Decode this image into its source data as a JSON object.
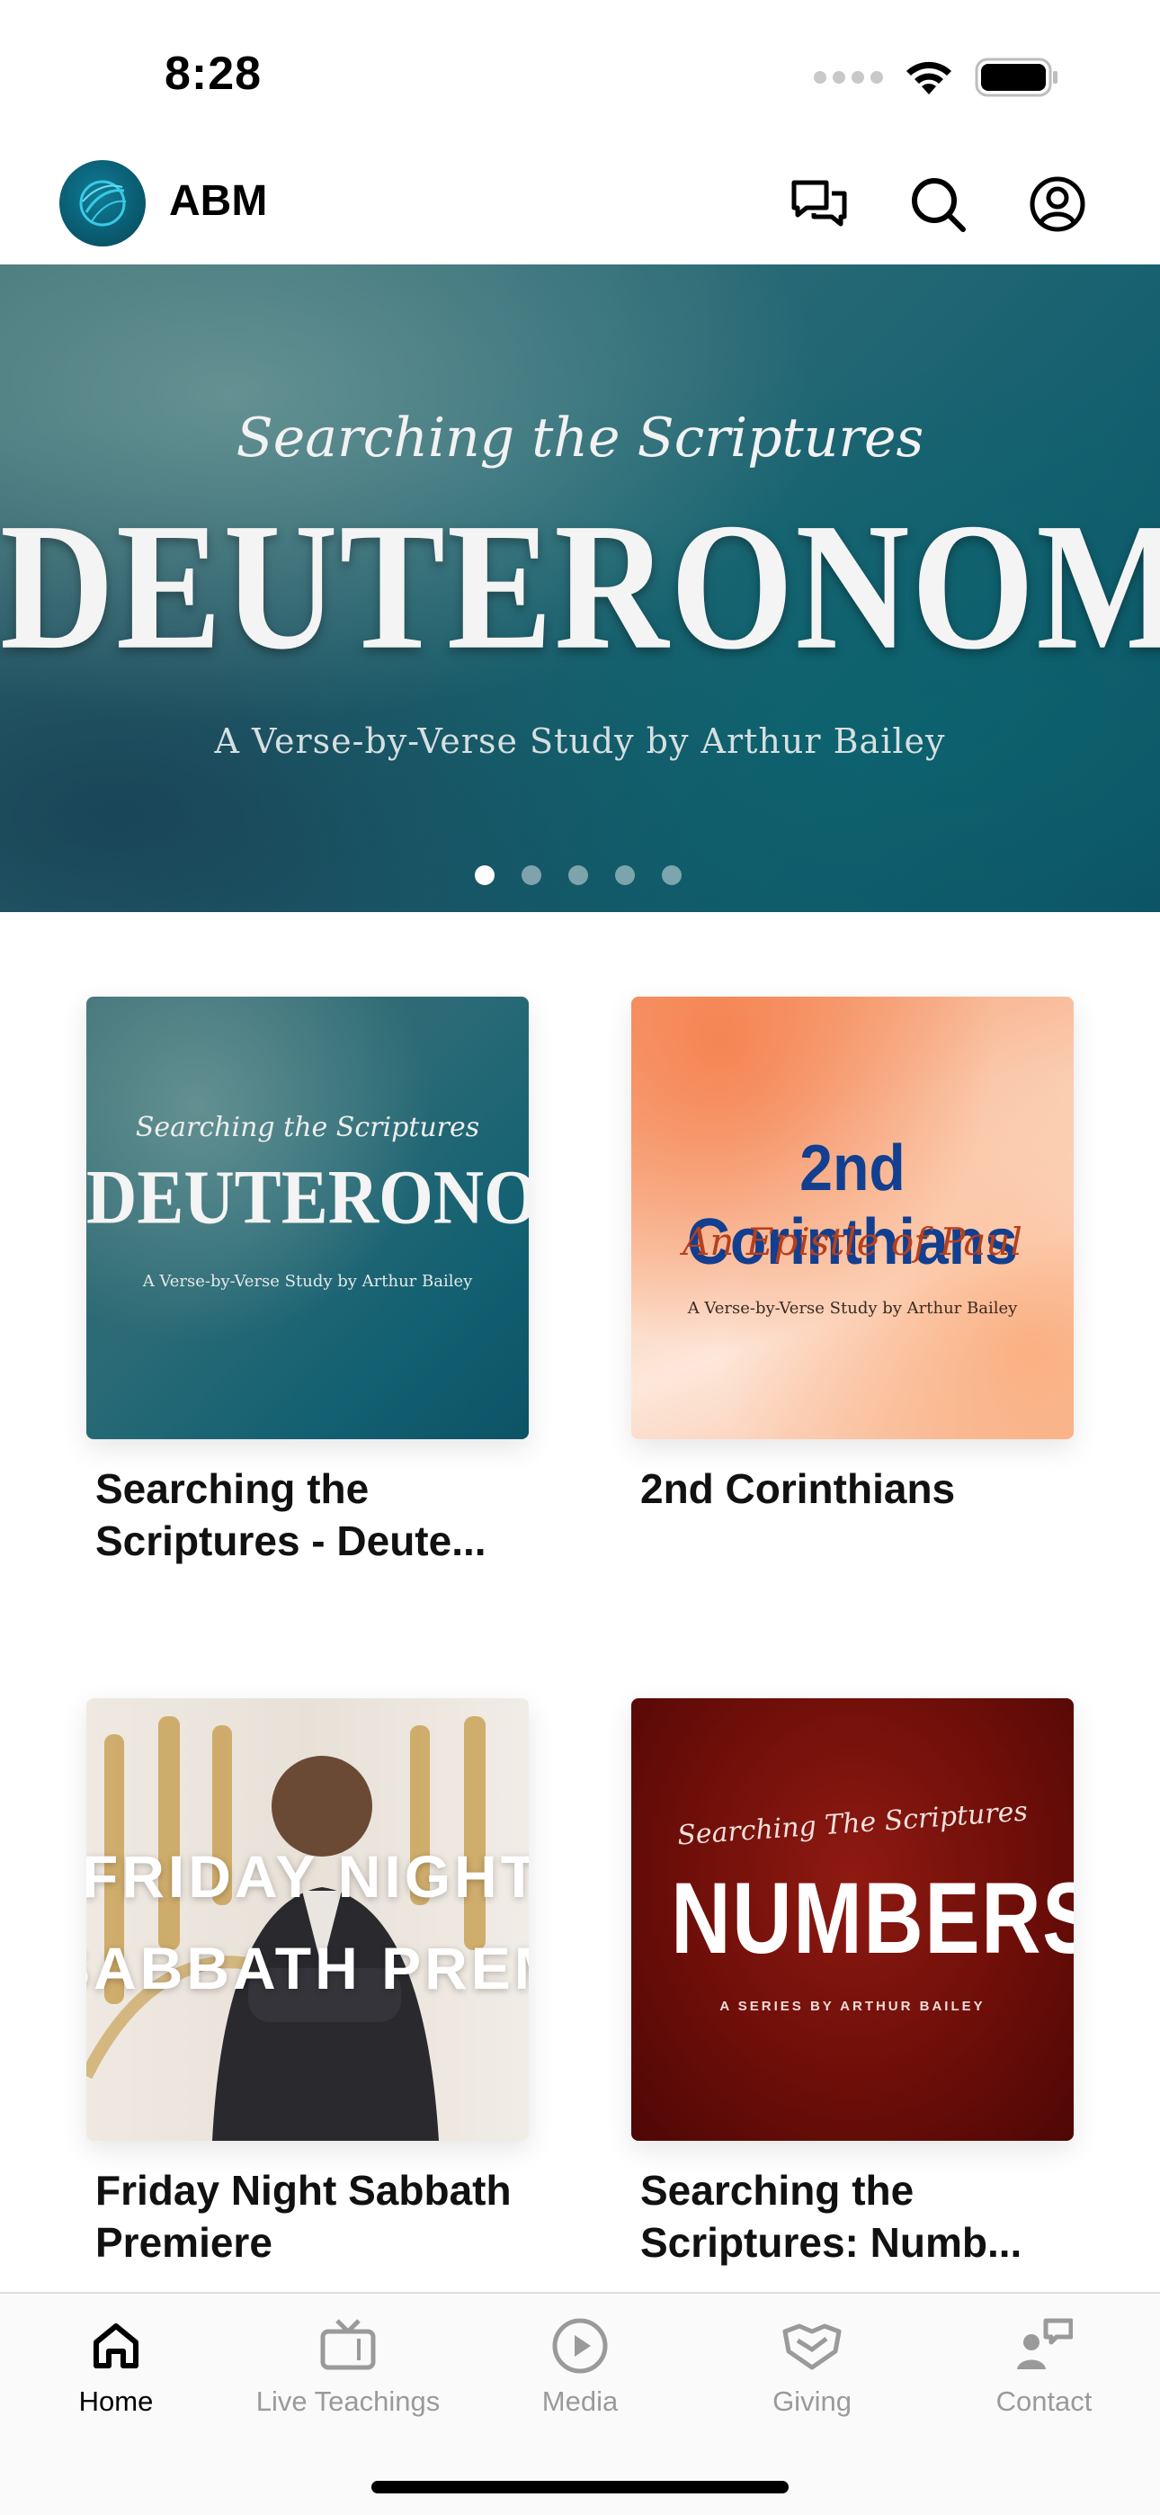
{
  "status_bar": {
    "time": "8:28",
    "icons": [
      "signal-icon",
      "wifi-icon",
      "battery-icon"
    ]
  },
  "header": {
    "app_title": "ABM",
    "logo_icon": "globe-logo-icon",
    "actions": [
      "chat-icon",
      "search-icon",
      "profile-icon"
    ]
  },
  "hero": {
    "script_line": "Searching the Scriptures",
    "title": "DEUTERONOMY",
    "subtitle": "A Verse-by-Verse Study by Arthur Bailey",
    "page_count": 5,
    "active_page": 1
  },
  "items": [
    {
      "title": "Searching the Scriptures - Deute...",
      "art": {
        "line1": "Searching the Scriptures",
        "line2": "DEUTERONOMY",
        "line3": "A Verse-by-Verse Study by Arthur Bailey"
      }
    },
    {
      "title": "2nd Corinthians",
      "art": {
        "line1": "2nd Corinthians",
        "line2": "An Epistle of Paul",
        "line3": "A Verse-by-Verse Study by Arthur Bailey"
      }
    },
    {
      "title": "Friday Night Sabbath Premiere",
      "art": {
        "line1": "FRIDAY NIGHT",
        "line2": "SABBATH PREMIERE"
      }
    },
    {
      "title": "Searching the Scriptures: Numb...",
      "art": {
        "line1": "Searching The Scriptures",
        "line2": "NUMBERS",
        "line3": "A SERIES BY ARTHUR BAILEY"
      }
    }
  ],
  "tab_bar": {
    "tabs": [
      {
        "label": "Home",
        "icon": "home-icon",
        "active": true
      },
      {
        "label": "Live Teachings",
        "icon": "tv-icon",
        "active": false
      },
      {
        "label": "Media",
        "icon": "play-circle-icon",
        "active": false
      },
      {
        "label": "Giving",
        "icon": "giving-icon",
        "active": false
      },
      {
        "label": "Contact",
        "icon": "contact-icon",
        "active": false
      }
    ]
  },
  "colors": {
    "active_tab": "#000000",
    "inactive_tab": "#9a9a9a",
    "hero_teal": "#1f6a76"
  }
}
